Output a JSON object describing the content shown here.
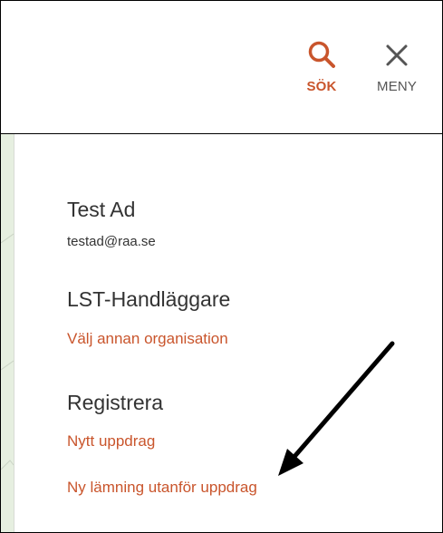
{
  "header": {
    "search_label": "SÖK",
    "menu_label": "MENY"
  },
  "colors": {
    "accent": "#c9552c",
    "text": "#333333",
    "menu_text": "#555555"
  },
  "user": {
    "name": "Test Ad",
    "email": "testad@raa.se"
  },
  "role": {
    "title": "LST-Handläggare",
    "change_org_link": "Välj annan organisation"
  },
  "register": {
    "title": "Registrera",
    "links": [
      "Nytt uppdrag",
      "Ny lämning utanför uppdrag"
    ]
  },
  "icons": {
    "search": "search-icon",
    "close": "close-icon",
    "annotation": "arrow-annotation-icon"
  }
}
